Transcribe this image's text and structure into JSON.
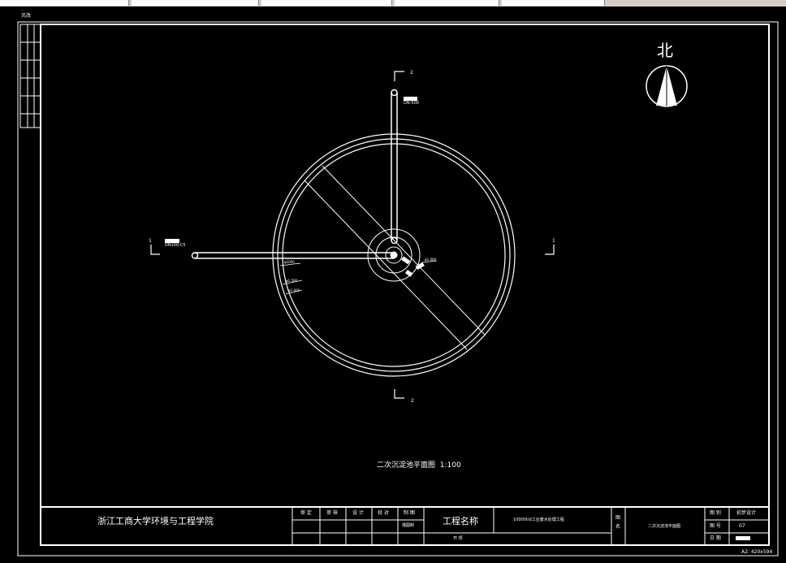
{
  "window": {
    "segments": 6
  },
  "margin_label": "另改",
  "north": {
    "label": "北"
  },
  "drawing": {
    "title": "二次沉淀池平面图",
    "scale": "1:100",
    "section_marks": {
      "vertical": "1",
      "horizontal": "2"
    },
    "pipe_labels": {
      "inlet": "DN100-C5",
      "outlet": "DN-500",
      "dim_a": "φ1000",
      "dim_b": "φ1.500",
      "dim_c": "φ1.000",
      "dim_d": "φ1.000"
    }
  },
  "title_block": {
    "institution": "浙江工商大学环境与工程学院",
    "roles": [
      "审 定",
      "审 核",
      "设 计",
      "校 对",
      "制 图"
    ],
    "sub_role": "描图制",
    "project_label": "工程名称",
    "project_name": "10000t/d工业废水处理工程",
    "stage_label": "开 项",
    "drawing_name_label": "图 名",
    "drawing_name": "二次沉淀池平面图",
    "category_label": "图 别",
    "category_value": "初步设计",
    "number_label": "图 号",
    "number_value": "07",
    "date_label": "日 期"
  },
  "paper_size": "A2: 420x594"
}
